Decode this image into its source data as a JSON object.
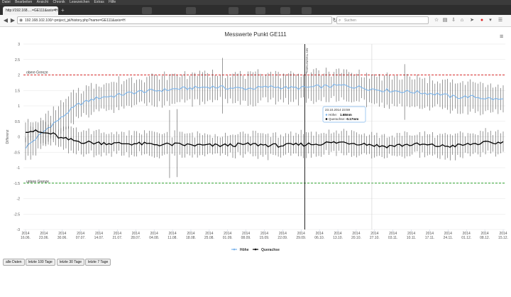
{
  "browser": {
    "menu_items": [
      "Datei",
      "Bearbeiten",
      "Ansicht",
      "Chronik",
      "Lesezeichen",
      "Extras",
      "Hilfe"
    ],
    "tab_title": "http://192.168.…=GE111&axis=H",
    "url": "192.168.102.100/~project_jsl/history.php?name=GE111&axis=H",
    "search_placeholder": "Suchen"
  },
  "chart_data": {
    "type": "line",
    "title": "Messwerte Punkt GE111",
    "ylabel": "Differenz",
    "ylim": [
      -3,
      3
    ],
    "yticks": [
      3,
      2.5,
      2,
      1.5,
      1,
      0.5,
      0,
      -0.5,
      -1,
      -1.5,
      -2,
      -2.5,
      -3
    ],
    "x_tick_labels": [
      [
        "2014",
        "16.06."
      ],
      [
        "2014",
        "23.06."
      ],
      [
        "2014",
        "30.06."
      ],
      [
        "2014",
        "07.07."
      ],
      [
        "2014",
        "14.07."
      ],
      [
        "2014",
        "21.07."
      ],
      [
        "2014",
        "28.07."
      ],
      [
        "2014",
        "04.08."
      ],
      [
        "2014",
        "11.08."
      ],
      [
        "2014",
        "18.08."
      ],
      [
        "2014",
        "25.08."
      ],
      [
        "2014",
        "01.09."
      ],
      [
        "2014",
        "08.09."
      ],
      [
        "2014",
        "15.09."
      ],
      [
        "2014",
        "22.09."
      ],
      [
        "2014",
        "29.09."
      ],
      [
        "2014",
        "06.10."
      ],
      [
        "2014",
        "13.10."
      ],
      [
        "2014",
        "20.10."
      ],
      [
        "2014",
        "27.10."
      ],
      [
        "2014",
        "03.11."
      ],
      [
        "2014",
        "10.11."
      ],
      [
        "2014",
        "17.11."
      ],
      [
        "2014",
        "24.11."
      ],
      [
        "2014",
        "01.12."
      ],
      [
        "2014",
        "08.12."
      ],
      [
        "2014",
        "15.12."
      ]
    ],
    "plot_bands": {
      "upper": {
        "value": 2,
        "label": "obere Grenze",
        "color": "#d9302f"
      },
      "lower": {
        "value": -1.5,
        "label": "untere Grenze",
        "color": "#2ca02c"
      }
    },
    "vertical_marker": {
      "x": 15.2,
      "label": "Jahr Transformation"
    },
    "series": [
      {
        "name": "Höhe",
        "color": "#7cb5ec",
        "anchors": [
          [
            0,
            -0.35
          ],
          [
            2,
            -0.1
          ],
          [
            4,
            0.15
          ],
          [
            6,
            0.4
          ],
          [
            8,
            0.6
          ],
          [
            10,
            0.85
          ],
          [
            12,
            1.05
          ],
          [
            14,
            1.15
          ],
          [
            16,
            1.25
          ],
          [
            18,
            1.3
          ],
          [
            20,
            1.32
          ],
          [
            22,
            1.38
          ],
          [
            24,
            1.42
          ],
          [
            26,
            1.46
          ],
          [
            28,
            1.48
          ],
          [
            30,
            1.5
          ],
          [
            32,
            1.52
          ],
          [
            34,
            1.55
          ],
          [
            36,
            1.56
          ],
          [
            38,
            1.58
          ],
          [
            40,
            1.6
          ],
          [
            42,
            1.62
          ],
          [
            44,
            1.6
          ],
          [
            46,
            1.58
          ],
          [
            48,
            1.57
          ],
          [
            50,
            1.56
          ],
          [
            52,
            1.58
          ],
          [
            54,
            1.6
          ],
          [
            56,
            1.62
          ],
          [
            58,
            1.6
          ],
          [
            60,
            1.58
          ],
          [
            62,
            1.58
          ],
          [
            64,
            1.6
          ],
          [
            66,
            1.62
          ],
          [
            68,
            1.63
          ],
          [
            70,
            1.65
          ],
          [
            72,
            1.66
          ],
          [
            74,
            1.62
          ],
          [
            76,
            1.6
          ],
          [
            78,
            1.55
          ],
          [
            80,
            1.52
          ],
          [
            82,
            1.5
          ],
          [
            84,
            1.48
          ],
          [
            86,
            1.46
          ],
          [
            88,
            1.45
          ],
          [
            90,
            1.42
          ],
          [
            92,
            1.4
          ],
          [
            94,
            1.38
          ],
          [
            96,
            1.3
          ],
          [
            98,
            1.28
          ],
          [
            100,
            1.3
          ],
          [
            102,
            1.28
          ],
          [
            104,
            1.25
          ],
          [
            106,
            1.22
          ],
          [
            108,
            1.2
          ]
        ],
        "error_half": 0.45
      },
      {
        "name": "Querachse",
        "color": "#000000",
        "anchors": [
          [
            0,
            0.2
          ],
          [
            2,
            0.18
          ],
          [
            4,
            0.12
          ],
          [
            6,
            0.1
          ],
          [
            8,
            -0.05
          ],
          [
            10,
            -0.1
          ],
          [
            12,
            -0.15
          ],
          [
            14,
            -0.18
          ],
          [
            16,
            -0.2
          ],
          [
            18,
            -0.2
          ],
          [
            20,
            -0.22
          ],
          [
            22,
            -0.22
          ],
          [
            24,
            -0.22
          ],
          [
            26,
            -0.23
          ],
          [
            28,
            -0.24
          ],
          [
            30,
            -0.25
          ],
          [
            32,
            -0.25
          ],
          [
            34,
            -0.25
          ],
          [
            36,
            -0.26
          ],
          [
            38,
            -0.27
          ],
          [
            40,
            -0.28
          ],
          [
            42,
            -0.28
          ],
          [
            44,
            -0.28
          ],
          [
            46,
            -0.27
          ],
          [
            48,
            -0.26
          ],
          [
            50,
            -0.25
          ],
          [
            52,
            -0.25
          ],
          [
            54,
            -0.26
          ],
          [
            56,
            -0.28
          ],
          [
            58,
            -0.28
          ],
          [
            60,
            -0.27
          ],
          [
            62,
            -0.25
          ],
          [
            64,
            -0.24
          ],
          [
            66,
            -0.23
          ],
          [
            68,
            -0.2
          ],
          [
            70,
            -0.19
          ],
          [
            72,
            -0.18
          ],
          [
            74,
            -0.2
          ],
          [
            76,
            -0.22
          ],
          [
            78,
            -0.25
          ],
          [
            80,
            -0.3
          ],
          [
            82,
            -0.3
          ],
          [
            84,
            -0.28
          ],
          [
            86,
            -0.26
          ],
          [
            88,
            -0.25
          ],
          [
            90,
            -0.26
          ],
          [
            92,
            -0.28
          ],
          [
            94,
            -0.3
          ],
          [
            96,
            -0.3
          ],
          [
            98,
            -0.28
          ],
          [
            100,
            -0.25
          ],
          [
            102,
            -0.22
          ],
          [
            104,
            -0.2
          ],
          [
            106,
            -0.2
          ],
          [
            108,
            -0.18
          ]
        ],
        "error_half": 0.35
      }
    ],
    "tooltip": {
      "date": "23.10.2014 23:59",
      "hoehe_label": "Höhe:",
      "hoehe_value": "1.68mm",
      "quer_label": "Querachse:",
      "quer_value": "-0.17mm"
    },
    "legend_position": "bottom-center"
  },
  "buttons": [
    "alle Daten",
    "letzte 100 Tage",
    "letzte 30 Tage",
    "letzte 7 Tage"
  ]
}
